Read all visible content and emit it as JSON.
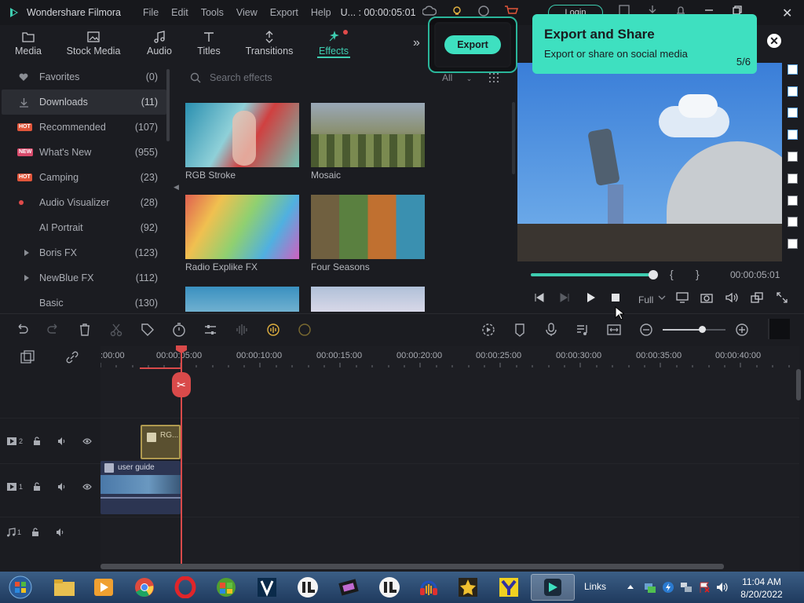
{
  "title_bar": {
    "app_name": "Wondershare Filmora",
    "menu": [
      "File",
      "Edit",
      "Tools",
      "View",
      "Export",
      "Help"
    ],
    "project": "U... : 00:00:05:01",
    "login_label": "Login"
  },
  "top_tabs": [
    {
      "label": "Media",
      "icon": "folder-icon"
    },
    {
      "label": "Stock Media",
      "icon": "image-icon"
    },
    {
      "label": "Audio",
      "icon": "music-note-icon"
    },
    {
      "label": "Titles",
      "icon": "text-icon"
    },
    {
      "label": "Transitions",
      "icon": "transition-icon"
    },
    {
      "label": "Effects",
      "icon": "effects-icon",
      "active": true
    }
  ],
  "sidebar": {
    "items": [
      {
        "label": "Favorites",
        "count": "(0)",
        "icon": "heart-icon"
      },
      {
        "label": "Downloads",
        "count": "(11)",
        "icon": "download-icon",
        "active": true
      },
      {
        "label": "Recommended",
        "count": "(107)",
        "badge": "HOT"
      },
      {
        "label": "What's New",
        "count": "(955)",
        "badge": "NEW"
      },
      {
        "label": "Camping",
        "count": "(23)",
        "badge": "HOT"
      },
      {
        "label": "Audio Visualizer",
        "count": "(28)",
        "dot": true
      },
      {
        "label": "AI Portrait",
        "count": "(92)"
      },
      {
        "label": "Boris FX",
        "count": "(123)",
        "expand": true
      },
      {
        "label": "NewBlue FX",
        "count": "(112)",
        "expand": true
      },
      {
        "label": "Basic",
        "count": "(130)"
      }
    ]
  },
  "search": {
    "placeholder": "Search effects",
    "filter": "All"
  },
  "effects": [
    {
      "label": "RGB Stroke"
    },
    {
      "label": "Mosaic"
    },
    {
      "label": "Radio Explike FX"
    },
    {
      "label": "Four Seasons"
    }
  ],
  "export": {
    "label": "Export"
  },
  "tooltip": {
    "title": "Export and Share",
    "subtitle": "Export or share on social media",
    "page": "5/6"
  },
  "player": {
    "timecode": "00:00:05:01",
    "quality": "Full",
    "progress": 0.98,
    "mark_in": "{",
    "mark_out": "}"
  },
  "timeline": {
    "ruler": [
      ":00:00",
      "00:00:05:00",
      "00:00:10:00",
      "00:00:15:00",
      "00:00:20:00",
      "00:00:25:00",
      "00:00:30:00",
      "00:00:35:00",
      "00:00:40:00"
    ],
    "tracks": [
      {
        "name": "2",
        "type": "video"
      },
      {
        "name": "1",
        "type": "video"
      },
      {
        "name": "1",
        "type": "audio"
      }
    ],
    "clips": {
      "fx": "RG...",
      "video": "user guide"
    }
  },
  "taskbar": {
    "links": "Links",
    "time": "11:04 AM",
    "date": "8/20/2022"
  },
  "colors": {
    "accent": "#3ecdb0",
    "tooltip": "#3ee0c0",
    "playhead": "#d94a4a"
  }
}
